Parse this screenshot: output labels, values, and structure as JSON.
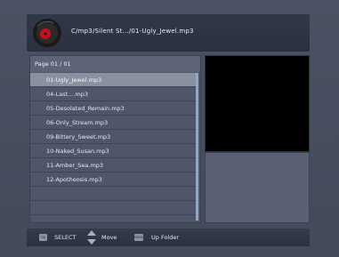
{
  "header": {
    "path": "C/mp3/Silent St.../01-Ugly_Jewel.mp3",
    "icon": "music-disc-icon"
  },
  "list": {
    "page_label": "Page 01 / 01",
    "items": [
      "01-Ugly_Jewel.mp3",
      "04-Last....mp3",
      "05-Desolated_Remain.mp3",
      "06-Only_Stream.mp3",
      "09-Bittery_Sweet.mp3",
      "10-Naked_Susan.mp3",
      "11-Amber_Sea.mp3",
      "12-Apotheosis.mp3"
    ],
    "selected_index": 0
  },
  "footer": {
    "ok_key": "OK",
    "ok_label": "SELECT",
    "move_label": "Move",
    "menu_key": "MENU",
    "menu_label": "Up Folder"
  },
  "colors": {
    "selection": "#8a90a0",
    "scrollbar": "#8fa8c8",
    "disc_red": "#c8101a"
  }
}
